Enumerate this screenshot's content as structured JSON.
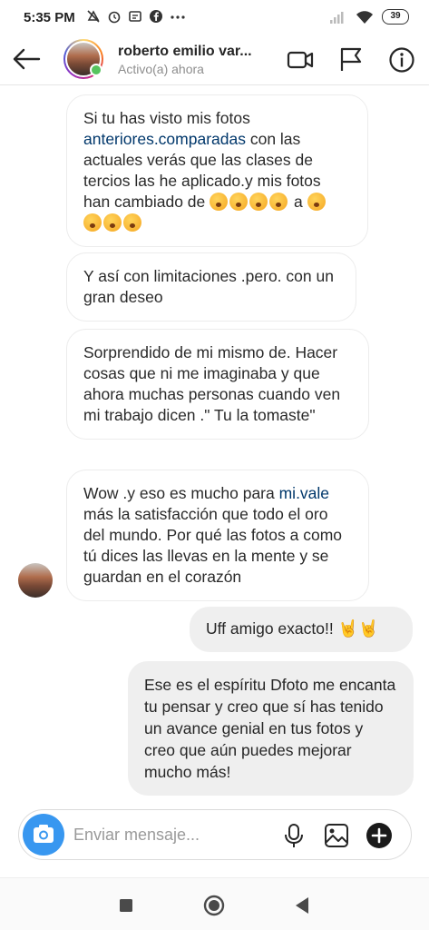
{
  "status_bar": {
    "time": "5:35 PM",
    "battery": "39"
  },
  "header": {
    "name": "roberto emilio var...",
    "status": "Activo(a) ahora"
  },
  "messages": {
    "m1": {
      "line1": "Si tu has visto mis fotos",
      "link": "anteriores.comparadas",
      "line2_rest": " con las",
      "line3": "actuales verás que las clases de",
      "line4": "tercios las he aplicado.y mis fotos",
      "line5": "han cambiado de ",
      "line5_end": " a "
    },
    "m2": {
      "text": "Y así con limitaciones .pero. con un gran deseo"
    },
    "m3": {
      "text": "Sorprendido de mi mismo de. Hacer cosas que ni me imaginaba y que ahora muchas personas cuando ven mi trabajo dicen .\" Tu la tomaste\""
    },
    "m4": {
      "start": "Wow .y eso es mucho para ",
      "link": "mi.vale",
      "rest": " más la satisfacción que todo el oro del mundo. Por qué las fotos a como tú dices las llevas en la mente y se guardan en el corazón"
    },
    "m5": {
      "text": "Uff amigo exacto!! "
    },
    "m6": {
      "text": "Ese es el espíritu Dfoto me encanta tu pensar y creo que sí has tenido un avance genial en tus fotos y creo que aún puedes mejorar mucho más!"
    }
  },
  "composer": {
    "placeholder": "Enviar mensaje..."
  },
  "icons": {
    "back": "arrow-left-icon",
    "video": "video-call-icon",
    "flag": "flag-icon",
    "info": "info-icon",
    "camera": "camera-icon",
    "mic": "microphone-icon",
    "gallery": "image-icon",
    "sticker": "plus-icon"
  },
  "colors": {
    "accent": "#3897f0",
    "link": "#00376b",
    "online": "#56c45e",
    "outgoing_bubble": "#efefef"
  }
}
